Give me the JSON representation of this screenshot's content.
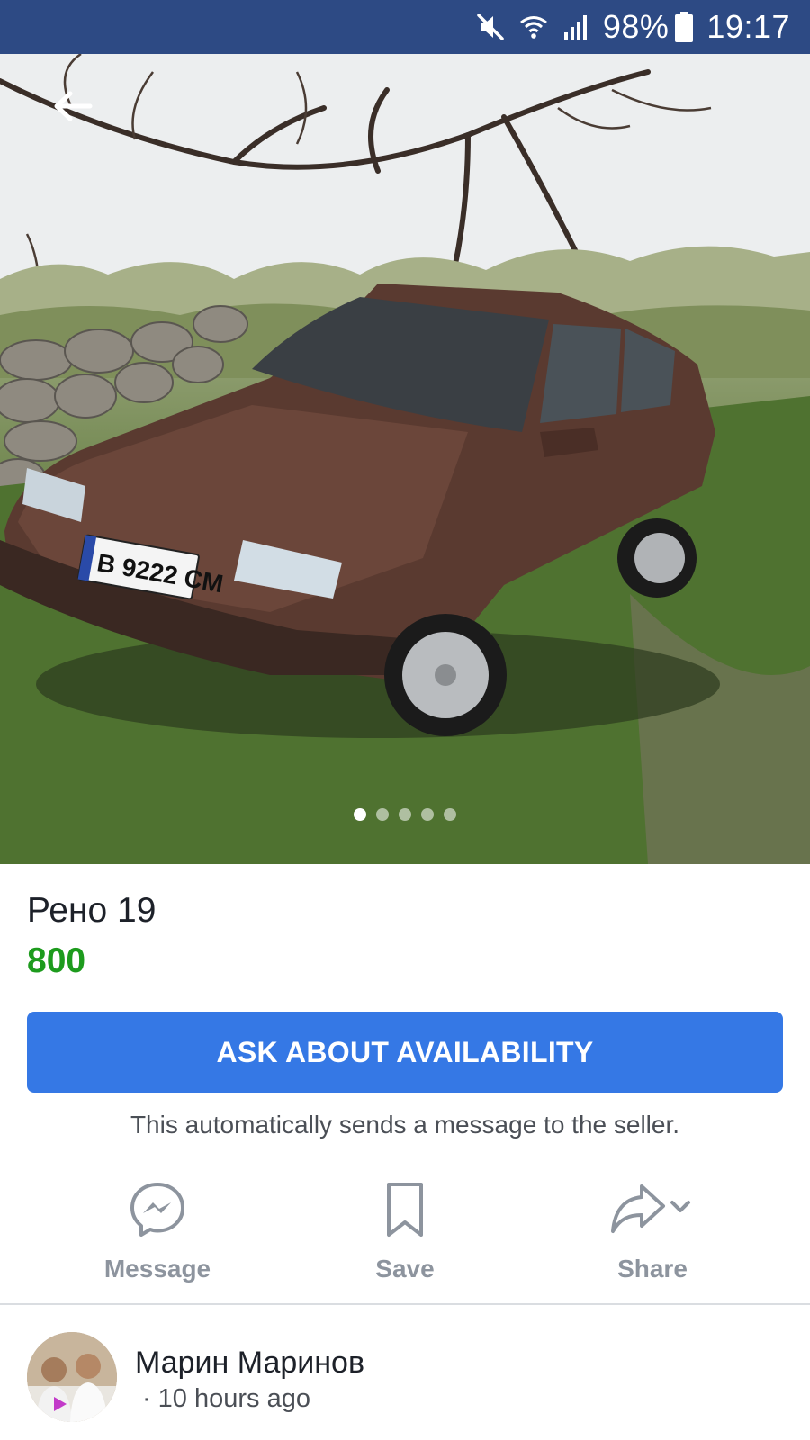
{
  "status_bar": {
    "battery": "98%",
    "time": "19:17",
    "icons": [
      "mute-icon",
      "wifi-icon",
      "signal-icon",
      "battery-icon"
    ],
    "background": "#2d4a84"
  },
  "photo": {
    "alt": "Photo of a brown Renault 19 sedan parked on grass",
    "carousel_count": 5,
    "active_index": 0
  },
  "listing": {
    "title": "Рено 19",
    "price": "800",
    "price_color": "#1d9b1d"
  },
  "cta": {
    "label": "ASK ABOUT AVAILABILITY",
    "note": "This automatically sends a message to the seller.",
    "color": "#3578e5"
  },
  "actions": {
    "message": "Message",
    "save": "Save",
    "share": "Share"
  },
  "seller": {
    "name": "Марин Маринов",
    "separator": "·",
    "time": "10 hours ago"
  }
}
